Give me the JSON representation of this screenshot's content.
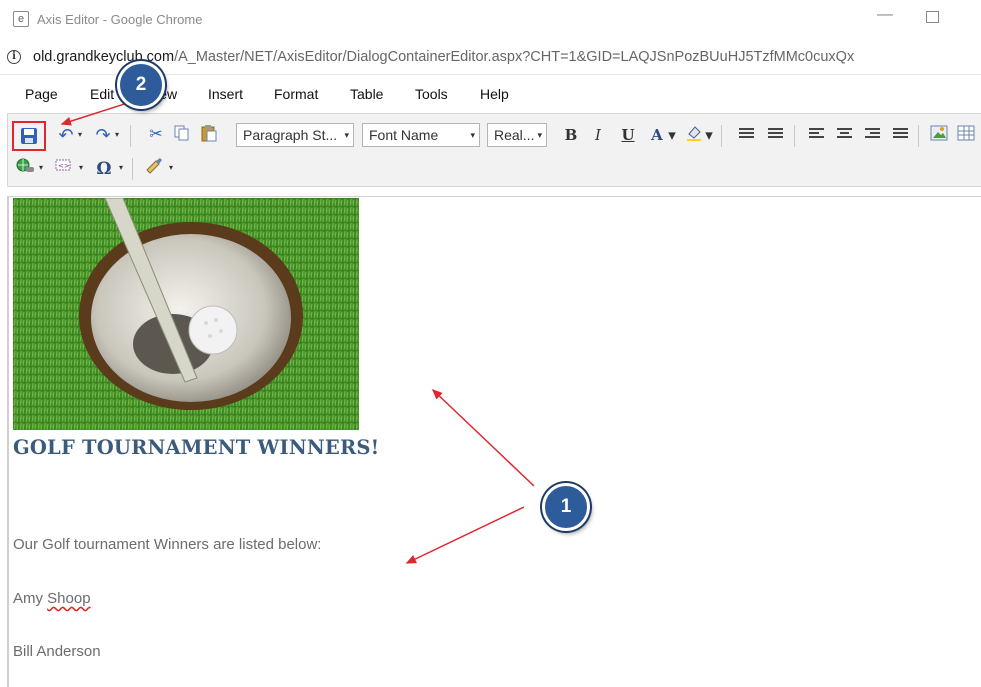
{
  "window": {
    "title": "Axis Editor - Google Chrome",
    "minimize_glyph": "—",
    "app_icon_glyph": "e"
  },
  "address_bar": {
    "info_glyph": "i",
    "url_host": "old.grandkeyclub.com",
    "url_rest": "/A_Master/NET/AxisEditor/DialogContainerEditor.aspx?CHT=1&GID=LAQJSnPozBUuHJ5TzfMMc0cuxQx"
  },
  "menu": {
    "items": [
      "Page",
      "Edit",
      "View",
      "Insert",
      "Format",
      "Table",
      "Tools",
      "Help"
    ]
  },
  "toolbar": {
    "paragraph_style": "Paragraph St...",
    "font_name": "Font Name",
    "font_size": "Real...",
    "bold": "B",
    "italic": "I",
    "underline": "U",
    "font_color": "A",
    "caret": "▾",
    "undo": "↶",
    "redo": "↷",
    "cut": "✂",
    "special_char": "Ω"
  },
  "content": {
    "heading": "GOLF TOURNAMENT WINNERS!",
    "intro": "Our Golf tournament Winners are listed below:",
    "winner1_first": "Amy",
    "winner1_last": "Shoop",
    "winner2": "Bill Anderson"
  },
  "callouts": {
    "one": "1",
    "two": "2"
  },
  "colors": {
    "heading": "#3b5b7d",
    "callout": "#2e5b9a",
    "arrow": "#e0262e",
    "save_highlight": "#e0262e"
  },
  "icons": [
    "save-icon",
    "undo-icon",
    "redo-icon",
    "cut-icon",
    "copy-icon",
    "paste-icon",
    "ordered-list-icon",
    "unordered-list-icon",
    "align-left-icon",
    "align-center-icon",
    "align-right-icon",
    "justify-icon",
    "insert-image-icon",
    "insert-table-icon",
    "hyperlink-icon",
    "insert-media-icon",
    "special-character-icon",
    "format-painter-icon",
    "highlight-color-icon"
  ]
}
